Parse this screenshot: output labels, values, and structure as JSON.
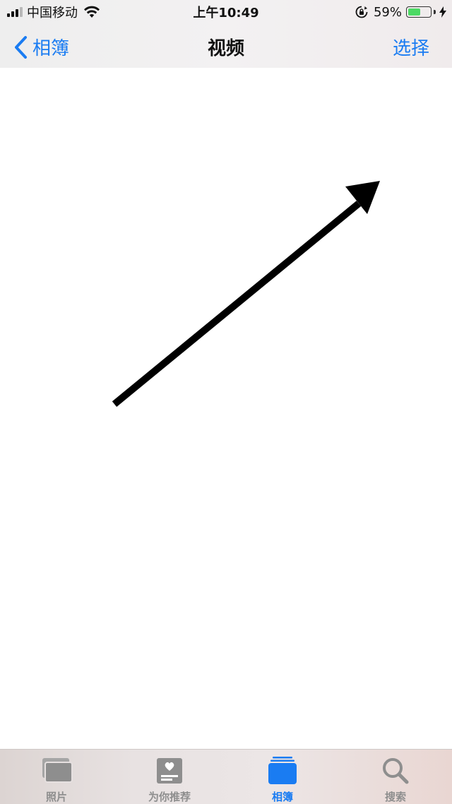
{
  "status_bar": {
    "carrier": "中国移动",
    "time": "上午10:49",
    "battery_percent_label": "59%",
    "battery_level": 0.59,
    "icons": [
      "signal-icon",
      "wifi-icon",
      "rotation-lock-icon",
      "battery-icon",
      "charging-bolt-icon"
    ]
  },
  "nav": {
    "back_label": "相簿",
    "title": "视频",
    "action_label": "选择"
  },
  "tabs": [
    {
      "label": "照片",
      "icon": "photos-icon",
      "active": false
    },
    {
      "label": "为你推荐",
      "icon": "for-you-icon",
      "active": false
    },
    {
      "label": "相簿",
      "icon": "albums-icon",
      "active": true
    },
    {
      "label": "搜索",
      "icon": "search-icon",
      "active": false
    }
  ],
  "colors": {
    "accent": "#1a7cf2",
    "inactive": "#8e8e8e",
    "battery_fill": "#4cd964"
  }
}
